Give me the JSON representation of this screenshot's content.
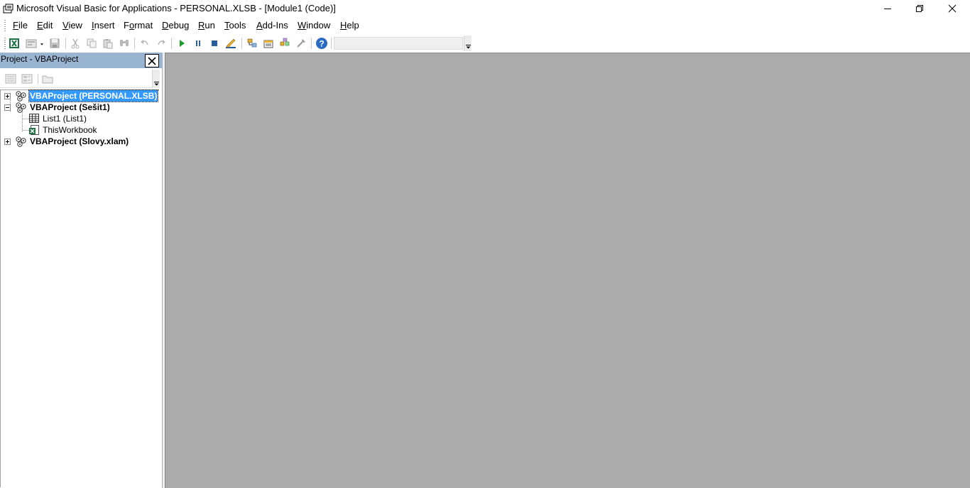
{
  "window": {
    "title": "Microsoft Visual Basic for Applications - PERSONAL.XLSB - [Module1 (Code)]",
    "controls": [
      "minimize-icon",
      "restore-icon",
      "close-icon"
    ]
  },
  "menu": [
    {
      "key": "F",
      "rest": "ile"
    },
    {
      "key": "E",
      "rest": "dit"
    },
    {
      "key": "V",
      "rest": "iew"
    },
    {
      "key": "I",
      "rest": "nsert"
    },
    {
      "key": "",
      "pre": "F",
      "mid": "o",
      "post": "rmat"
    },
    {
      "key": "D",
      "rest": "ebug"
    },
    {
      "key": "R",
      "rest": "un"
    },
    {
      "key": "T",
      "rest": "ools"
    },
    {
      "key": "A",
      "rest": "dd-Ins"
    },
    {
      "key": "W",
      "rest": "indow"
    },
    {
      "key": "H",
      "rest": "elp"
    }
  ],
  "menu_labels": [
    "File",
    "Edit",
    "View",
    "Insert",
    "Format",
    "Debug",
    "Run",
    "Tools",
    "Add-Ins",
    "Window",
    "Help"
  ],
  "toolbar": {
    "icons": [
      "excel-view-icon",
      "insert-module-icon",
      "save-icon",
      "cut-icon",
      "copy-icon",
      "paste-icon",
      "find-icon",
      "undo-icon",
      "redo-icon",
      "run-icon",
      "break-icon",
      "reset-icon",
      "design-mode-icon",
      "project-explorer-icon",
      "properties-icon",
      "object-browser-icon",
      "toolbox-icon",
      "help-icon"
    ]
  },
  "project_panel": {
    "title": "Project - VBAProject",
    "tree": [
      {
        "label": "VBAProject (PERSONAL.XLSB)",
        "bold": true,
        "selected": true,
        "expanded": false
      },
      {
        "label": "VBAProject (Sešit1)",
        "bold": true,
        "selected": false,
        "expanded": true
      },
      {
        "label": "List1 (List1)",
        "bold": false,
        "selected": false
      },
      {
        "label": "ThisWorkbook",
        "bold": false,
        "selected": false
      },
      {
        "label": "VBAProject (Slovy.xlam)",
        "bold": true,
        "selected": false,
        "expanded": false
      }
    ]
  },
  "colors": {
    "panel_header": "#99b4d1",
    "mdi_background": "#ababab",
    "selection": "#3399ff"
  }
}
